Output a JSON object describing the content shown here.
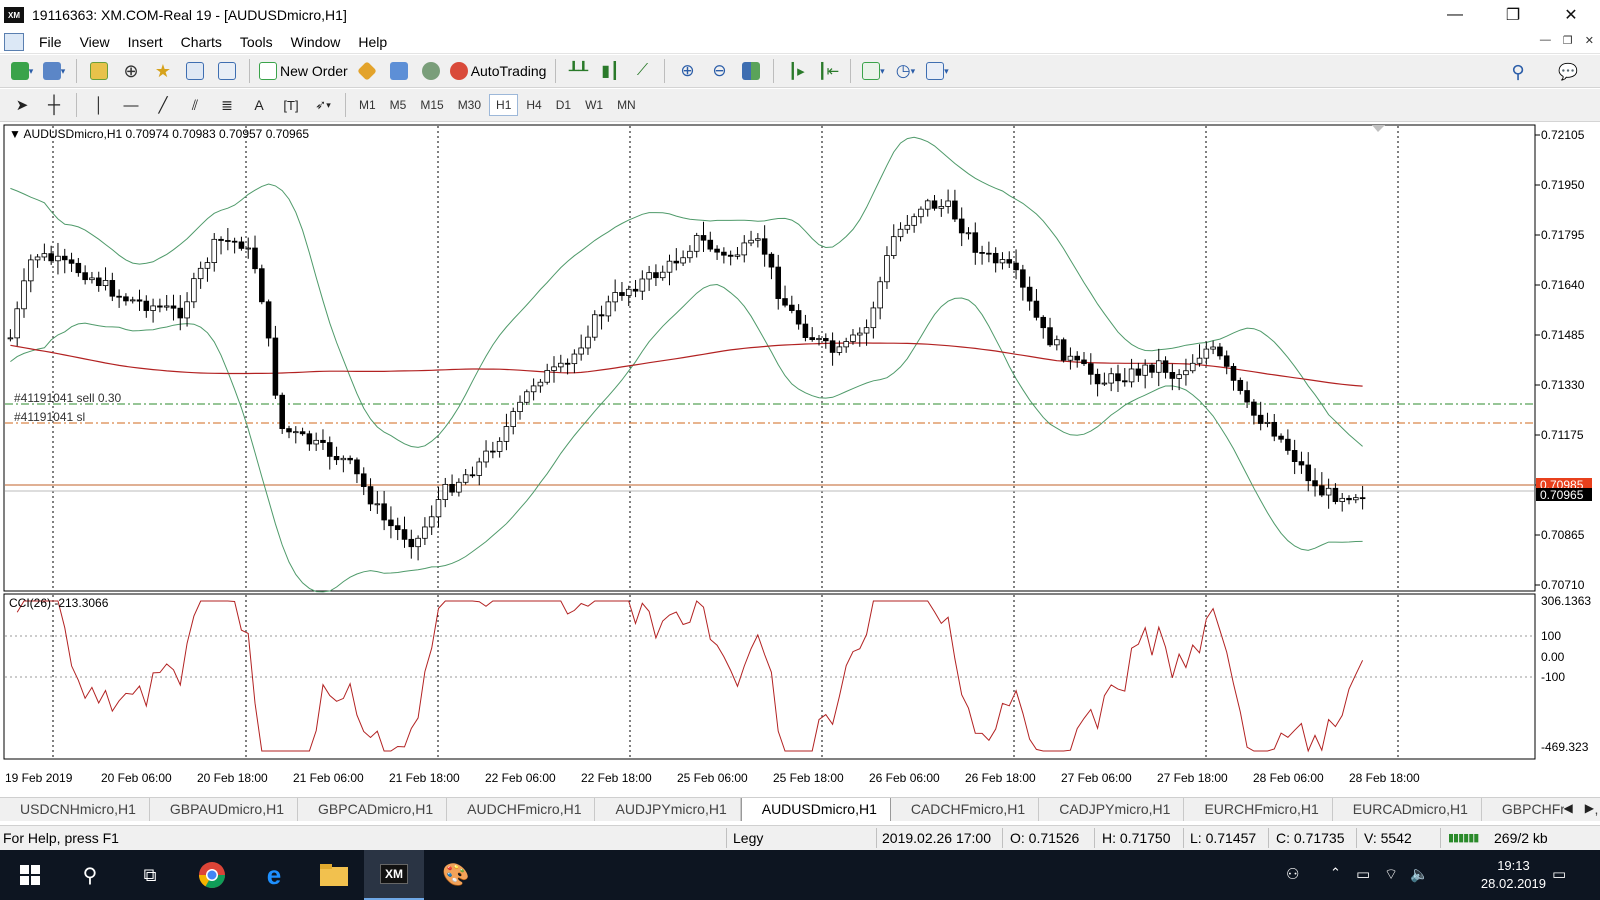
{
  "window": {
    "title": "19116363: XM.COM-Real 19 - [AUDUSDmicro,H1]",
    "logo_text": "XM",
    "minimize": "—",
    "maximize": "❐",
    "close": "✕"
  },
  "menu": [
    "File",
    "Insert",
    "Charts",
    "Tools",
    "Window",
    "Help"
  ],
  "toolbar": {
    "new_order": "New Order",
    "auto_trading": "AutoTrading"
  },
  "timeframes": [
    "M1",
    "M5",
    "M15",
    "M30",
    "H1",
    "H4",
    "D1",
    "W1",
    "MN"
  ],
  "active_timeframe": "H1",
  "chart": {
    "header": "AUDUSDmicro,H1  0.70974 0.70983 0.70957 0.70965",
    "order_sell_label": "#41191041 sell 0.30",
    "order_sl_label": "#41191041 sl",
    "current_price": "0.70965",
    "upper_price_tag": "0.70985",
    "price_axis": [
      "0.72105",
      "0.71950",
      "0.71795",
      "0.71640",
      "0.71485",
      "0.71330",
      "0.71175",
      "0.71020",
      "0.70865",
      "0.70710"
    ],
    "indicator_label": "CCI(26) -213.3066",
    "cci_axis": [
      "306.1363",
      "100",
      "0.00",
      "-100",
      "-469.323"
    ],
    "time_axis": [
      "19 Feb 2019",
      "20 Feb 06:00",
      "20 Feb 18:00",
      "21 Feb 06:00",
      "21 Feb 18:00",
      "22 Feb 06:00",
      "22 Feb 18:00",
      "25 Feb 06:00",
      "25 Feb 18:00",
      "26 Feb 06:00",
      "26 Feb 18:00",
      "27 Feb 06:00",
      "27 Feb 18:00",
      "28 Feb 06:00",
      "28 Feb 18:00"
    ],
    "colors": {
      "ma": "#b22222",
      "bands": "#4f9a6a",
      "cci": "#b22222",
      "sell_line": "#2e8b2e",
      "sl_line": "#d2691e",
      "bid_line": "#c0622a",
      "price_tag": "#e8401c"
    }
  },
  "tabs": [
    "USDCNHmicro,H1",
    "GBPAUDmicro,H1",
    "GBPCADmicro,H1",
    "AUDCHFmicro,H1",
    "AUDJPYmicro,H1",
    "AUDUSDmicro,H1",
    "CADCHFmicro,H1",
    "CADJPYmicro,H1",
    "EURCHFmicro,H1",
    "EURCADmicro,H1",
    "GBPCHFmicro,"
  ],
  "active_tab": "AUDUSDmicro,H1",
  "status": {
    "help": "For Help, press F1",
    "profile": "Legy",
    "datetime": "2019.02.26 17:00",
    "open": "O: 0.71526",
    "high": "H: 0.71750",
    "low": "L: 0.71457",
    "close": "C: 0.71735",
    "volume": "V: 5542",
    "traffic": "269/2 kb"
  },
  "taskbar": {
    "time": "19:13",
    "date": "28.02.2019"
  }
}
